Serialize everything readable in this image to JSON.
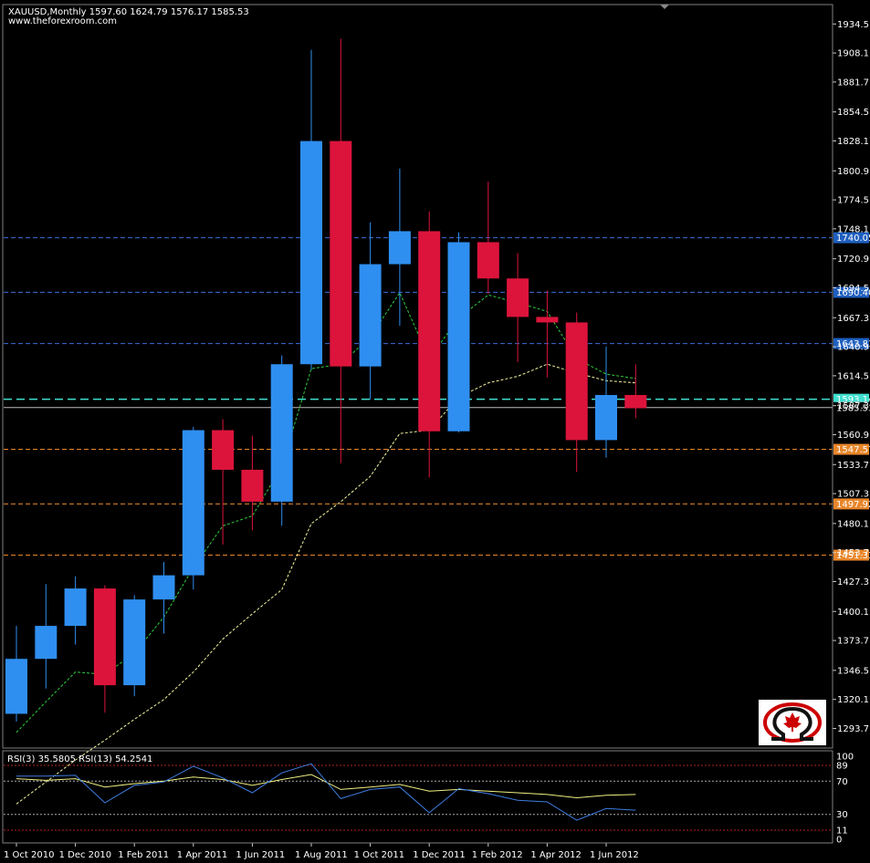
{
  "header": {
    "symbol_line": "XAUUSD,Monthly  1597.60 1624.79 1576.17 1585.53",
    "site": "www.theforexroom.com"
  },
  "colors": {
    "background": "#000000",
    "bull": "#2f8ff0",
    "bear": "#dc143c",
    "ma_fast": "#2ecc40",
    "ma_slow": "#f5f5a0",
    "rsi_fast": "#3d7de0",
    "rsi_slow": "#f0f080",
    "resistance": "#3a6fd8",
    "support": "#e8862a",
    "bid": "#40e0d0"
  },
  "chart_data": {
    "type": "candlestick",
    "ylim": [
      1280,
      1948
    ],
    "price_ticks": [
      1934.5,
      1908.1,
      1881.7,
      1854.5,
      1828.1,
      1800.9,
      1774.5,
      1748.1,
      1720.9,
      1694.5,
      1667.3,
      1640.9,
      1614.5,
      1587.3,
      1560.9,
      1533.7,
      1507.3,
      1480.1,
      1453.7,
      1427.3,
      1400.1,
      1373.7,
      1346.5,
      1320.1,
      1293.7
    ],
    "x_labels": [
      "1 Oct 2010",
      "1 Dec 2010",
      "1 Feb 2011",
      "1 Apr 2011",
      "1 Jun 2011",
      "1 Aug 2011",
      "1 Oct 2011",
      "1 Dec 2011",
      "1 Feb 2012",
      "1 Apr 2012",
      "1 Jun 2012"
    ],
    "candles": [
      {
        "o": 1307,
        "h": 1387,
        "l": 1300,
        "c": 1357
      },
      {
        "o": 1357,
        "h": 1425,
        "l": 1330,
        "c": 1387
      },
      {
        "o": 1387,
        "h": 1432,
        "l": 1370,
        "c": 1421
      },
      {
        "o": 1421,
        "h": 1424,
        "l": 1308,
        "c": 1333
      },
      {
        "o": 1333,
        "h": 1415,
        "l": 1323,
        "c": 1411
      },
      {
        "o": 1411,
        "h": 1445,
        "l": 1380,
        "c": 1433
      },
      {
        "o": 1433,
        "h": 1568,
        "l": 1420,
        "c": 1565
      },
      {
        "o": 1565,
        "h": 1575,
        "l": 1461,
        "c": 1529
      },
      {
        "o": 1529,
        "h": 1560,
        "l": 1474,
        "c": 1500
      },
      {
        "o": 1500,
        "h": 1633,
        "l": 1478,
        "c": 1625
      },
      {
        "o": 1625,
        "h": 1911,
        "l": 1620,
        "c": 1828
      },
      {
        "o": 1828,
        "h": 1921,
        "l": 1535,
        "c": 1623
      },
      {
        "o": 1623,
        "h": 1754,
        "l": 1593,
        "c": 1716
      },
      {
        "o": 1716,
        "h": 1803,
        "l": 1660,
        "c": 1746
      },
      {
        "o": 1746,
        "h": 1764,
        "l": 1522,
        "c": 1564
      },
      {
        "o": 1564,
        "h": 1745,
        "l": 1563,
        "c": 1736
      },
      {
        "o": 1736,
        "h": 1791,
        "l": 1689,
        "c": 1703
      },
      {
        "o": 1703,
        "h": 1726,
        "l": 1627,
        "c": 1668
      },
      {
        "o": 1668,
        "h": 1692,
        "l": 1613,
        "c": 1663
      },
      {
        "o": 1663,
        "h": 1672,
        "l": 1527,
        "c": 1556
      },
      {
        "o": 1556,
        "h": 1641,
        "l": 1540,
        "c": 1597
      },
      {
        "o": 1597,
        "h": 1625,
        "l": 1576,
        "c": 1585
      }
    ],
    "ma_fast": [
      1290,
      1318,
      1345,
      1343,
      1362,
      1395,
      1440,
      1478,
      1487,
      1532,
      1621,
      1625,
      1650,
      1690,
      1630,
      1667,
      1688,
      1681,
      1673,
      1630,
      1616,
      1612
    ],
    "ma_slow": [
      1225,
      1245,
      1265,
      1283,
      1302,
      1320,
      1345,
      1375,
      1398,
      1420,
      1480,
      1500,
      1523,
      1562,
      1565,
      1595,
      1608,
      1614,
      1625,
      1617,
      1610,
      1608
    ],
    "levels": [
      {
        "value": 1740.05,
        "label": "1740.05",
        "kind": "resistance"
      },
      {
        "value": 1690.4,
        "label": "1690.40",
        "kind": "resistance"
      },
      {
        "value": 1643.81,
        "label": "1643.81",
        "kind": "resistance"
      },
      {
        "value": 1593.14,
        "label": "1593.14",
        "kind": "bid"
      },
      {
        "value": 1547.57,
        "label": "1547.57",
        "kind": "support"
      },
      {
        "value": 1497.92,
        "label": "1497.92",
        "kind": "support"
      },
      {
        "value": 1451.33,
        "label": "1451.33",
        "kind": "support"
      }
    ],
    "current_price": {
      "value": 1585.53,
      "label": "1585.53"
    },
    "rsi": {
      "title": "RSI(3) 35.5805  RSI(13) 54.2541",
      "ticks": [
        {
          "v": 100,
          "label": "100"
        },
        {
          "v": 89,
          "label": "89"
        },
        {
          "v": 70,
          "label": "70"
        },
        {
          "v": 30,
          "label": "30"
        },
        {
          "v": 11,
          "label": "11"
        },
        {
          "v": 0,
          "label": "0"
        }
      ],
      "rsi3": [
        76,
        76,
        77,
        44,
        65,
        69,
        88,
        74,
        56,
        80,
        91,
        49,
        60,
        63,
        32,
        61,
        55,
        47,
        45,
        23,
        37,
        35
      ],
      "rsi13": [
        73,
        71,
        73,
        63,
        67,
        70,
        75,
        72,
        65,
        72,
        78,
        60,
        63,
        66,
        58,
        60,
        58,
        56,
        54,
        50,
        53,
        54
      ]
    }
  }
}
